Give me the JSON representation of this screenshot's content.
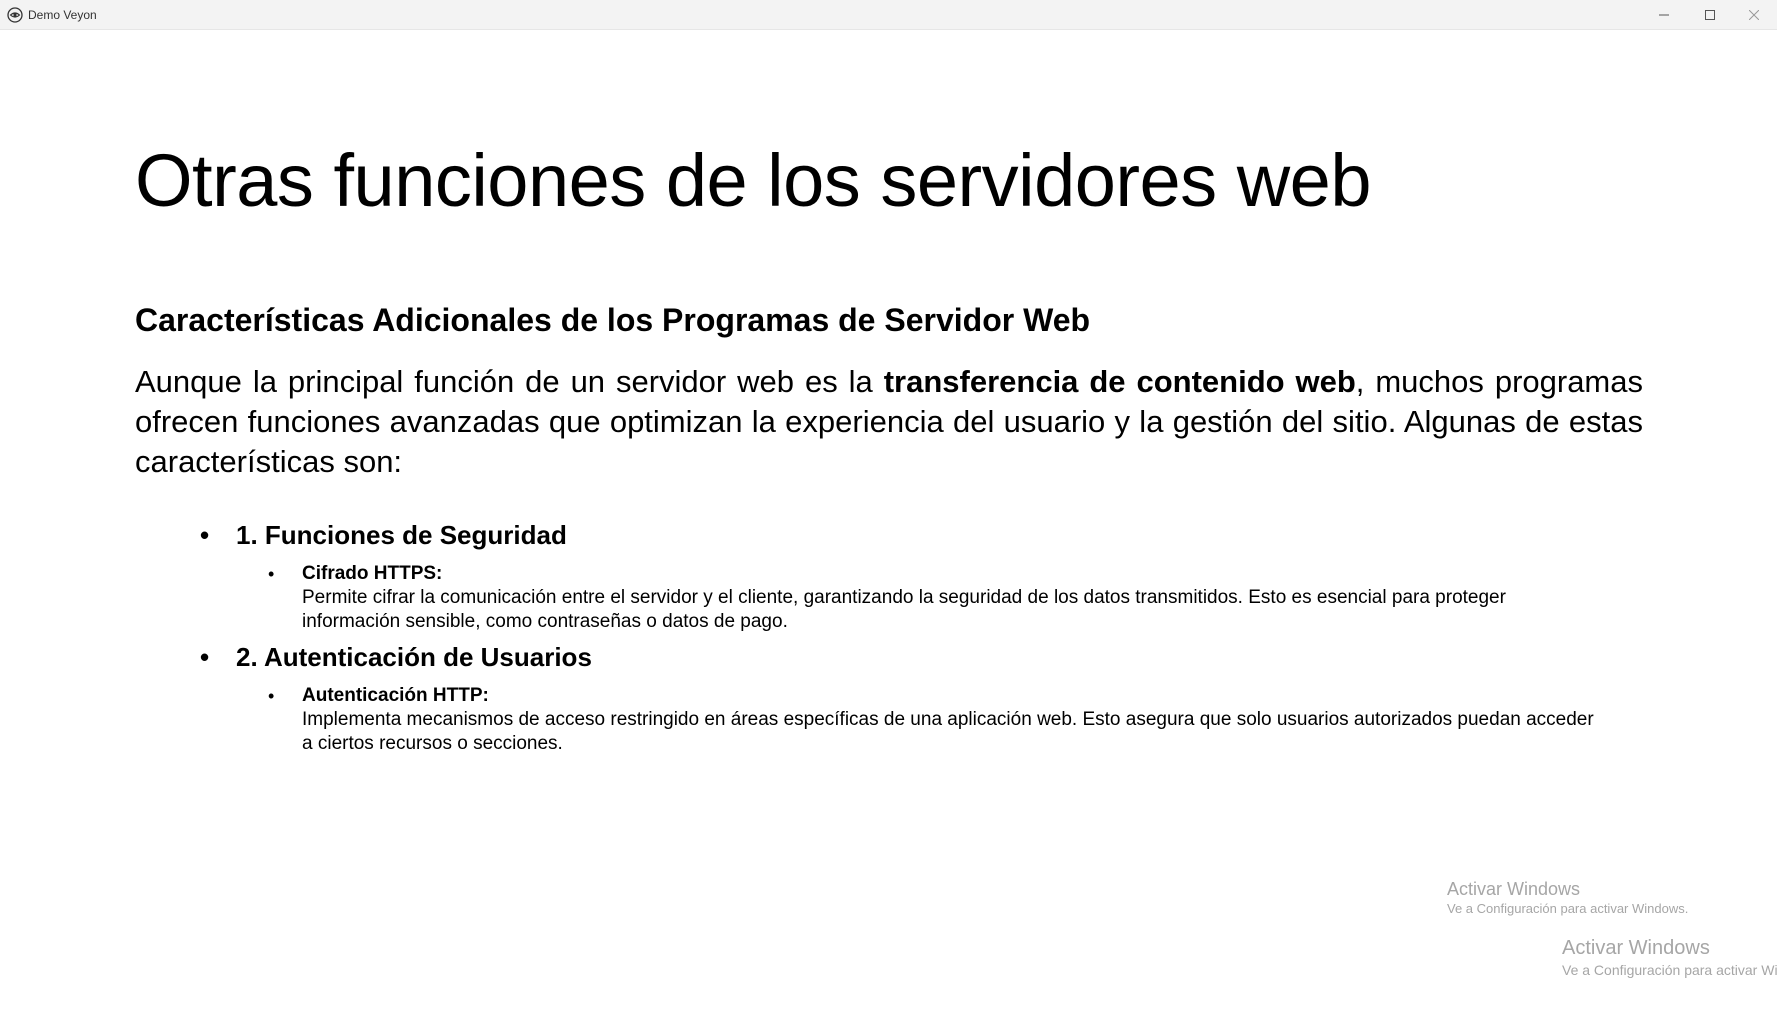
{
  "window": {
    "title": "Demo Veyon"
  },
  "slide": {
    "title": "Otras funciones de los servidores web",
    "heading": "Características Adicionales de los Programas de Servidor Web",
    "intro_before": "Aunque la principal función de un servidor web es la ",
    "intro_bold": "transferencia de contenido web",
    "intro_after": ", muchos programas ofrecen funciones avanzadas que optimizan la experiencia del usuario y la gestión del sitio. Algunas de estas características son:",
    "sections": [
      {
        "label": "1. Funciones de Seguridad",
        "item_title": "Cifrado HTTPS:",
        "item_text": "Permite cifrar la comunicación entre el servidor y el cliente, garantizando la seguridad de los datos transmitidos. Esto es esencial para proteger información sensible, como contraseñas o datos de pago."
      },
      {
        "label": "2. Autenticación de Usuarios",
        "item_title": "Autenticación HTTP:",
        "item_text": "Implementa mecanismos de acceso restringido en áreas específicas de una aplicación web. Esto asegura que solo usuarios autorizados puedan acceder a ciertos recursos o secciones."
      }
    ],
    "bullet_char": "•"
  },
  "watermarks": [
    {
      "title": "Activar Windows",
      "subtitle": "Ve a Configuración para activar Windows."
    },
    {
      "title": "Activar Windows",
      "subtitle": "Ve a Configuración para activar Windows."
    }
  ],
  "icons": {
    "app": "veyon-eye-icon",
    "minimize": "minimize-icon",
    "maximize": "maximize-icon",
    "close": "close-icon"
  },
  "colors": {
    "titlebar": "#f3f3f3",
    "text": "#000000",
    "watermark": "#a6a6a6"
  }
}
